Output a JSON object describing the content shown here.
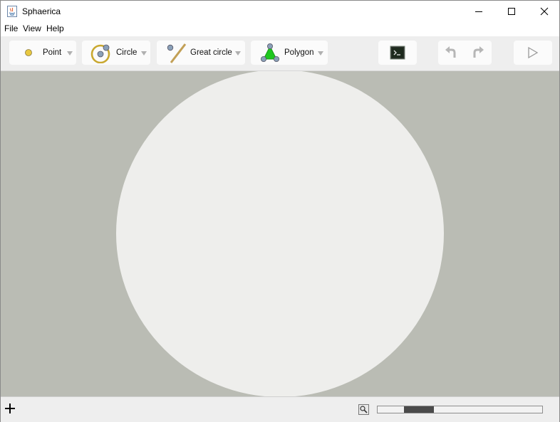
{
  "window": {
    "title": "Sphaerica"
  },
  "menu": {
    "items": [
      "File",
      "View",
      "Help"
    ]
  },
  "toolbar": {
    "point_label": "Point",
    "circle_label": "Circle",
    "great_circle_label": "Great circle",
    "polygon_label": "Polygon"
  },
  "colors": {
    "canvas_bg": "#babcb4",
    "sphere_fill": "#eeeeec",
    "toolbar_bg": "#eeeeee",
    "polygon_green": "#1ec71e",
    "point_yellow": "#e8c840"
  },
  "zoom_slider": {
    "start_fraction": 0.16,
    "end_fraction": 0.34
  }
}
